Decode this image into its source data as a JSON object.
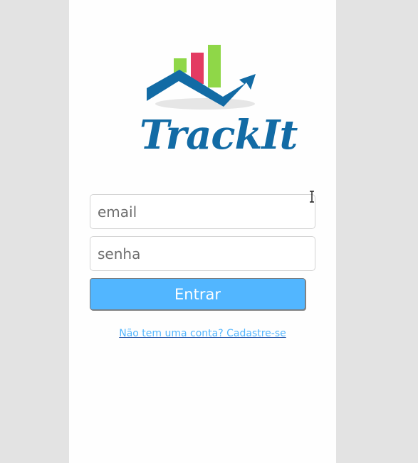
{
  "app": {
    "name": "TrackIt"
  },
  "logo": {
    "text": "TrackIt",
    "icon": "bar-chart-with-trend-arrow",
    "colors": {
      "primary": "#126ba5",
      "bar_green": "#8fd748",
      "bar_red": "#e33b62",
      "shadow": "#e6e6e6"
    }
  },
  "form": {
    "email_placeholder": "email",
    "email_value": "",
    "password_placeholder": "senha",
    "password_value": "",
    "submit_label": "Entrar"
  },
  "signup": {
    "label": "Não tem uma conta? Cadastre-se"
  },
  "colors": {
    "accent": "#52b6ff",
    "background": "#e3e3e3",
    "panel": "#fefefe"
  },
  "cursor": {
    "icon": "text-cursor-icon"
  }
}
